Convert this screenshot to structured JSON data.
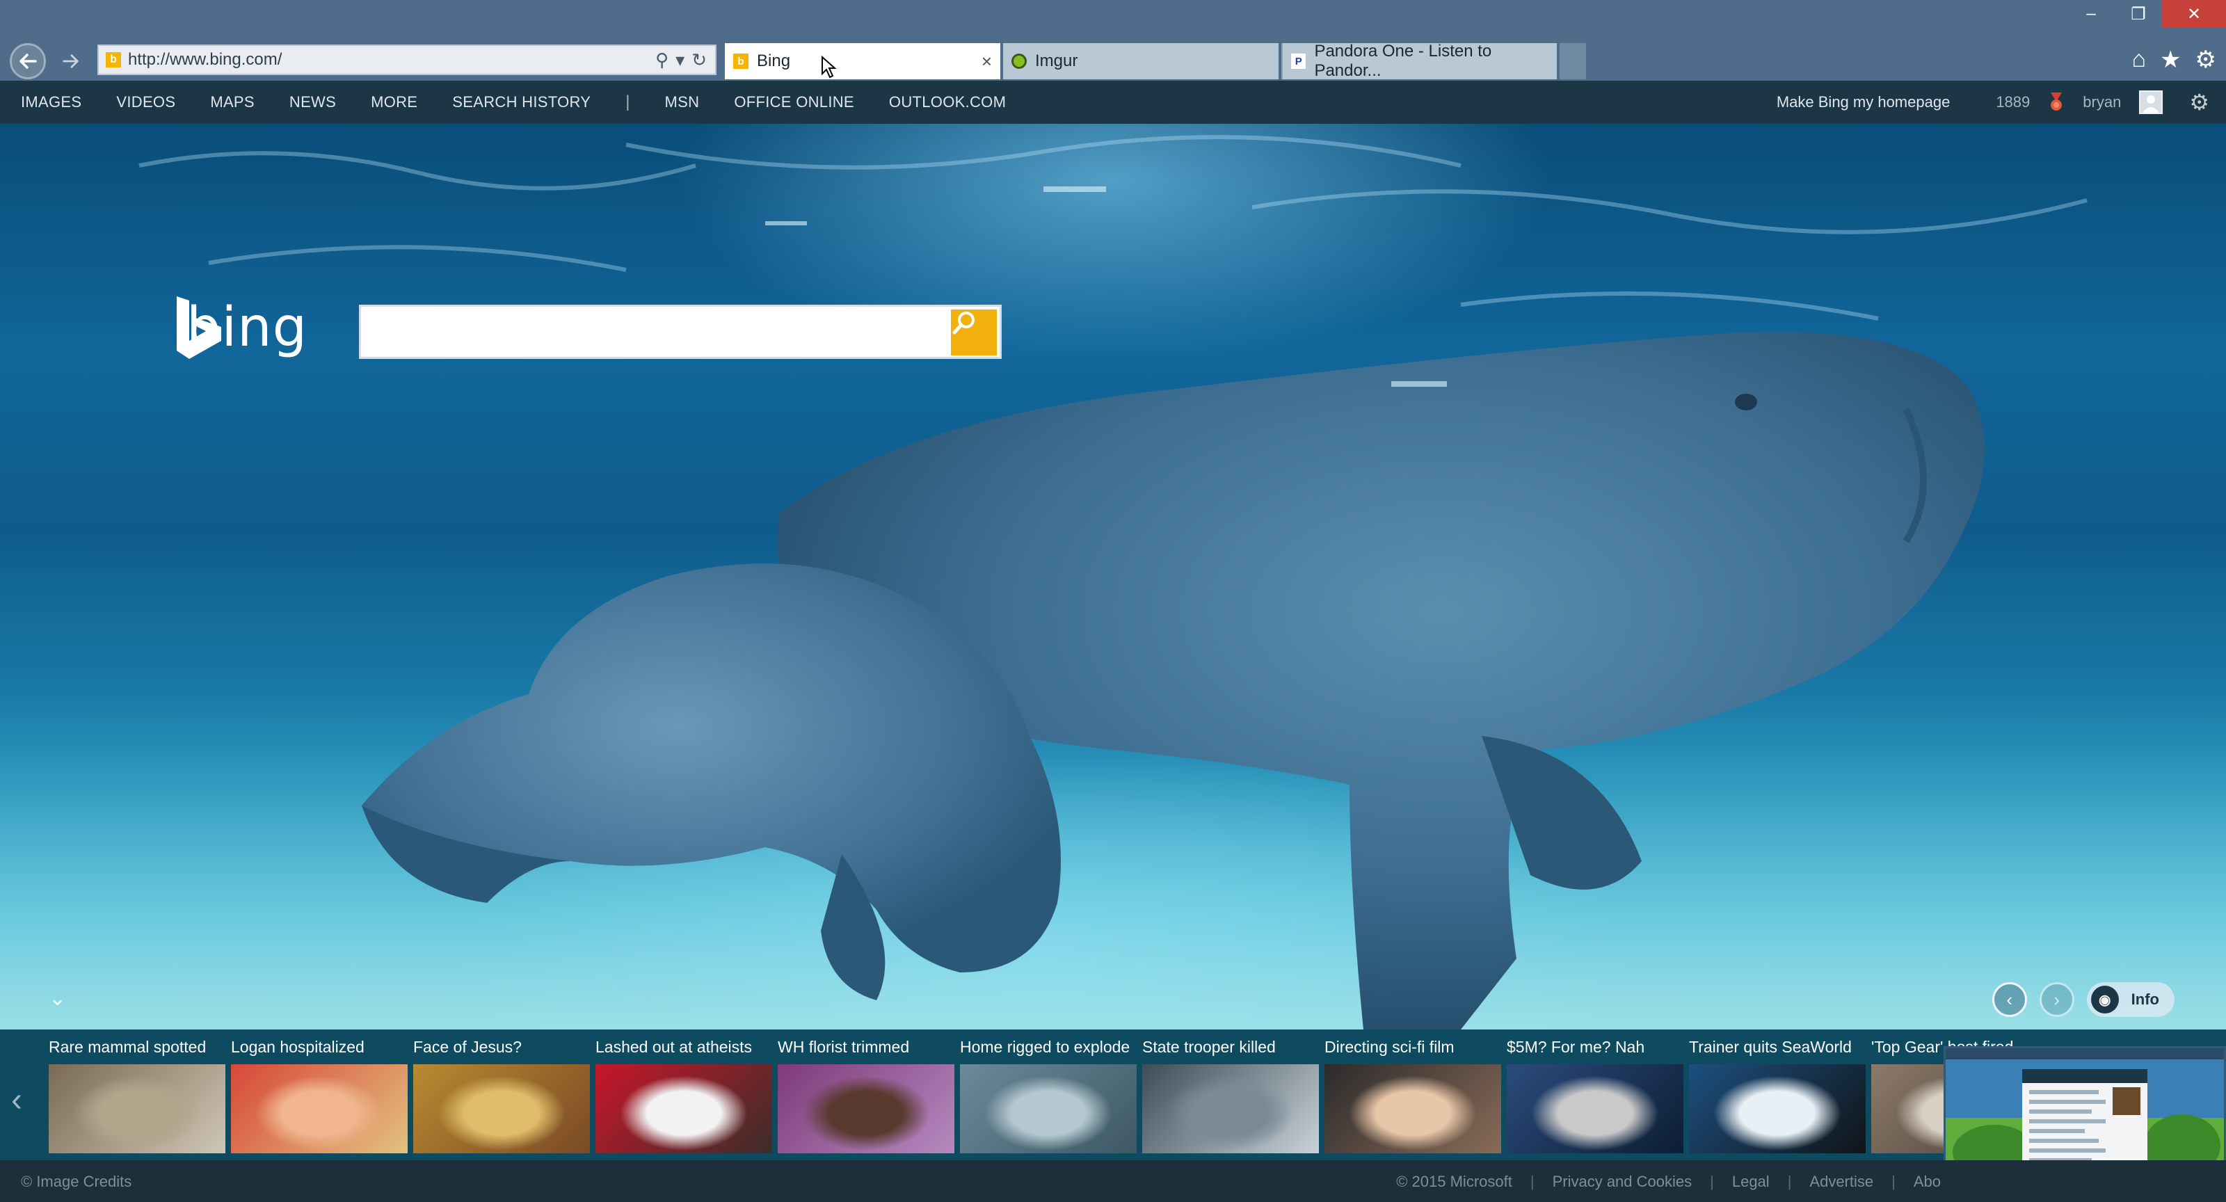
{
  "window": {
    "minimize": "‒",
    "maximize": "❐",
    "close": "✕"
  },
  "browser": {
    "url": "http://www.bing.com/",
    "tabs": [
      {
        "label": "Bing",
        "favicon": "b",
        "favicon_color": "#f5b400"
      },
      {
        "label": "Imgur",
        "favicon": "",
        "favicon_color": "#85bf25"
      },
      {
        "label": "Pandora One - Listen to Pandor...",
        "favicon": "P",
        "favicon_color": "#224099"
      }
    ]
  },
  "bing_nav": {
    "links": [
      "IMAGES",
      "VIDEOS",
      "MAPS",
      "NEWS",
      "MORE",
      "SEARCH HISTORY"
    ],
    "separator": "|",
    "links2": [
      "MSN",
      "OFFICE ONLINE",
      "OUTLOOK.COM"
    ],
    "homepage": "Make Bing my homepage",
    "rewards_count": "1889",
    "user": "bryan"
  },
  "logo": {
    "text": "bing"
  },
  "search": {
    "value": "",
    "placeholder": ""
  },
  "hero_controls": {
    "info_label": "Info"
  },
  "news": [
    {
      "title": "Rare mammal spotted",
      "palette": [
        "#7a6a55",
        "#b3a58b",
        "#cfc6b4"
      ]
    },
    {
      "title": "Logan hospitalized",
      "palette": [
        "#d84739",
        "#f0b58f",
        "#e2c27f"
      ]
    },
    {
      "title": "Face of Jesus?",
      "palette": [
        "#b88a31",
        "#e0bd6b",
        "#7a4a25"
      ]
    },
    {
      "title": "Lashed out at atheists",
      "palette": [
        "#c8162a",
        "#f2f2f2",
        "#3b2e2a"
      ]
    },
    {
      "title": "WH florist trimmed",
      "palette": [
        "#7e3b79",
        "#5a3a2f",
        "#b58abf"
      ]
    },
    {
      "title": "Home rigged to explode",
      "palette": [
        "#6a8b9a",
        "#b5c8d0",
        "#3e5864"
      ]
    },
    {
      "title": "State trooper killed",
      "palette": [
        "#3d4c57",
        "#7a8a96",
        "#c9d2d8"
      ]
    },
    {
      "title": "Directing sci-fi film",
      "palette": [
        "#2b2b2b",
        "#e8c7a8",
        "#8a6b58"
      ]
    },
    {
      "title": "$5M? For me? Nah",
      "palette": [
        "#2a4c7c",
        "#c9c9c9",
        "#0d1d33"
      ]
    },
    {
      "title": "Trainer quits SeaWorld",
      "palette": [
        "#1d4f7f",
        "#e8f0f6",
        "#101418"
      ]
    },
    {
      "title": "'Top Gear' host fired",
      "palette": [
        "#8c7a6a",
        "#d8cfc5",
        "#4b3f36"
      ]
    }
  ],
  "footer": {
    "credits": "© Image Credits",
    "links": [
      "© 2015 Microsoft",
      "Privacy and Cookies",
      "Legal",
      "Advertise",
      "Abo"
    ]
  }
}
